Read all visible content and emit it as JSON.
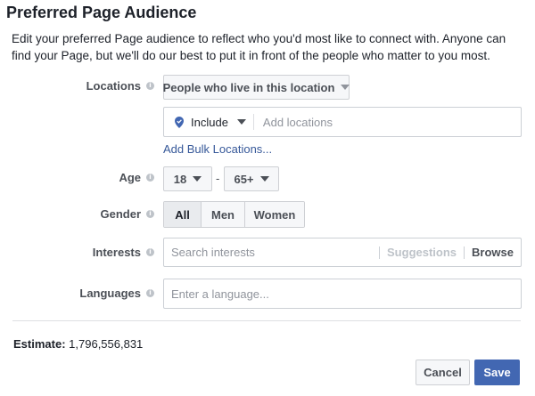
{
  "dialog": {
    "title": "Preferred Page Audience",
    "description": "Edit your preferred Page audience to reflect who you'd most like to connect with. Anyone can find your Page, but we'll do our best to put it in front of the people who matter to you most."
  },
  "locations": {
    "label": "Locations",
    "scope_dropdown": "People who live in this location",
    "include_dropdown": "Include",
    "input_placeholder": "Add locations",
    "bulk_link": "Add Bulk Locations..."
  },
  "age": {
    "label": "Age",
    "min": "18",
    "separator": "-",
    "max": "65+"
  },
  "gender": {
    "label": "Gender",
    "options": [
      "All",
      "Men",
      "Women"
    ],
    "selected": "All"
  },
  "interests": {
    "label": "Interests",
    "placeholder": "Search interests",
    "suggestions_label": "Suggestions",
    "browse_label": "Browse"
  },
  "languages": {
    "label": "Languages",
    "placeholder": "Enter a language..."
  },
  "estimate": {
    "label": "Estimate:",
    "value": "1,796,556,831"
  },
  "footer": {
    "cancel_label": "Cancel",
    "save_label": "Save"
  },
  "colors": {
    "primary": "#4267b2",
    "link": "#365899",
    "pin": "#4267b2"
  }
}
